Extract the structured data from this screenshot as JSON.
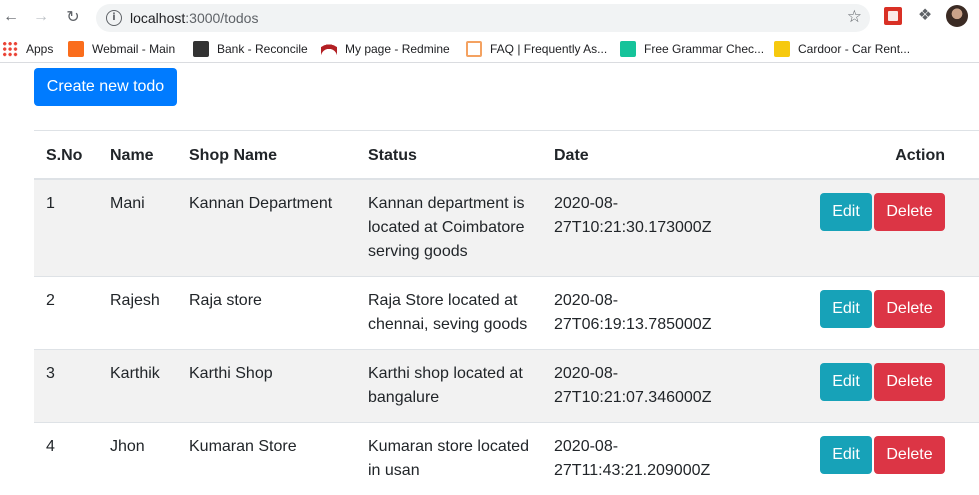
{
  "browser": {
    "url_host": "localhost",
    "url_path": ":3000/todos"
  },
  "bookmarks": [
    {
      "label": "Apps",
      "icon": "apps-grid-icon"
    },
    {
      "label": "Webmail - Main",
      "icon": "cpanel-icon"
    },
    {
      "label": "Bank - Reconcile",
      "icon": "bank-icon"
    },
    {
      "label": "My page - Redmine",
      "icon": "redmine-icon"
    },
    {
      "label": "FAQ | Frequently As...",
      "icon": "faq-icon"
    },
    {
      "label": "Free Grammar Chec...",
      "icon": "grammar-icon"
    },
    {
      "label": "Cardoor - Car Rent...",
      "icon": "cardoor-icon"
    }
  ],
  "page": {
    "create_label": "Create new todo",
    "headers": {
      "sno": "S.No",
      "name": "Name",
      "shop": "Shop Name",
      "status": "Status",
      "date": "Date",
      "action": "Action"
    },
    "edit_label": "Edit",
    "delete_label": "Delete",
    "rows": [
      {
        "sno": "1",
        "name": "Mani",
        "shop": "Kannan Department",
        "status": "Kannan department is located at Coimbatore serving goods",
        "date": "2020-08-27T10:21:30.173000Z"
      },
      {
        "sno": "2",
        "name": "Rajesh",
        "shop": "Raja store",
        "status": "Raja Store located at chennai, seving goods",
        "date": "2020-08-27T06:19:13.785000Z"
      },
      {
        "sno": "3",
        "name": "Karthik",
        "shop": "Karthi Shop",
        "status": "Karthi shop located at bangalure",
        "date": "2020-08-27T10:21:07.346000Z"
      },
      {
        "sno": "4",
        "name": "Jhon",
        "shop": "Kumaran Store",
        "status": "Kumaran store located in usan",
        "date": "2020-08-27T11:43:21.209000Z"
      }
    ]
  },
  "colors": {
    "primary": "#007bff",
    "info": "#17a2b8",
    "danger": "#dc3545",
    "stripe": "#f2f2f2"
  }
}
